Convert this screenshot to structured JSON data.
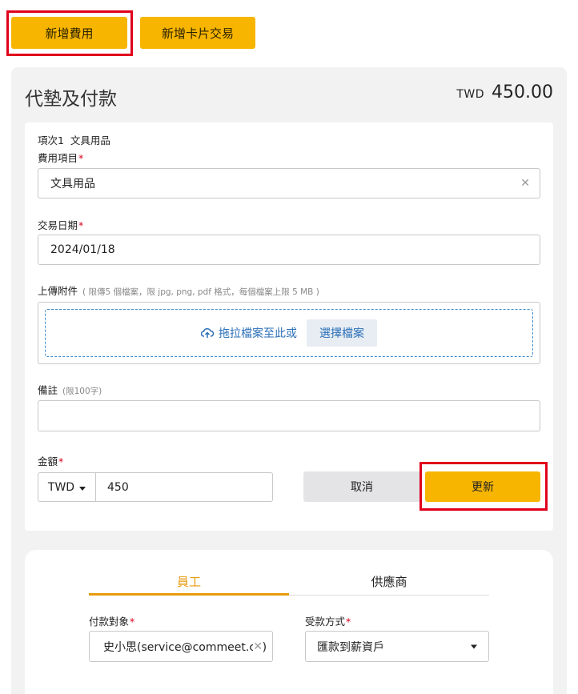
{
  "top_buttons": {
    "add_expense": "新增費用",
    "add_card_transaction": "新增卡片交易"
  },
  "panel": {
    "title": "代墊及付款",
    "total_currency": "TWD",
    "total_amount": "450.00"
  },
  "item": {
    "index_label": "項次1",
    "index_name": "文具用品",
    "expense_item_label": "費用項目",
    "expense_item_value": "文具用品",
    "transaction_date_label": "交易日期",
    "transaction_date_value": "2024/01/18",
    "attachment_label": "上傳附件",
    "attachment_hint": "( 限傳5 個檔案，限 jpg, png, pdf 格式，每個檔案上限 5 MB )",
    "drop_text": "拖拉檔案至此或",
    "choose_file": "選擇檔案",
    "note_label": "備註",
    "note_hint": "(限100字)",
    "note_value": "",
    "amount_label": "金額",
    "amount_currency": "TWD",
    "amount_value": "450",
    "cancel": "取消",
    "update": "更新"
  },
  "payment": {
    "tabs": [
      "員工",
      "供應商"
    ],
    "active_tab": "員工",
    "payee_label": "付款對象",
    "payee_value": "史小思(service@commeet.co)",
    "method_label": "受款方式",
    "method_value": "匯款到薪資戶"
  },
  "colors": {
    "accent": "#f7b500",
    "tab_active": "#e89a10",
    "link": "#2b6fb8",
    "required": "#d9001b",
    "highlight": "#e0001b"
  },
  "icons": {
    "clear": "close-icon",
    "upload": "cloud-upload-icon",
    "dropdown": "caret-down-icon"
  }
}
